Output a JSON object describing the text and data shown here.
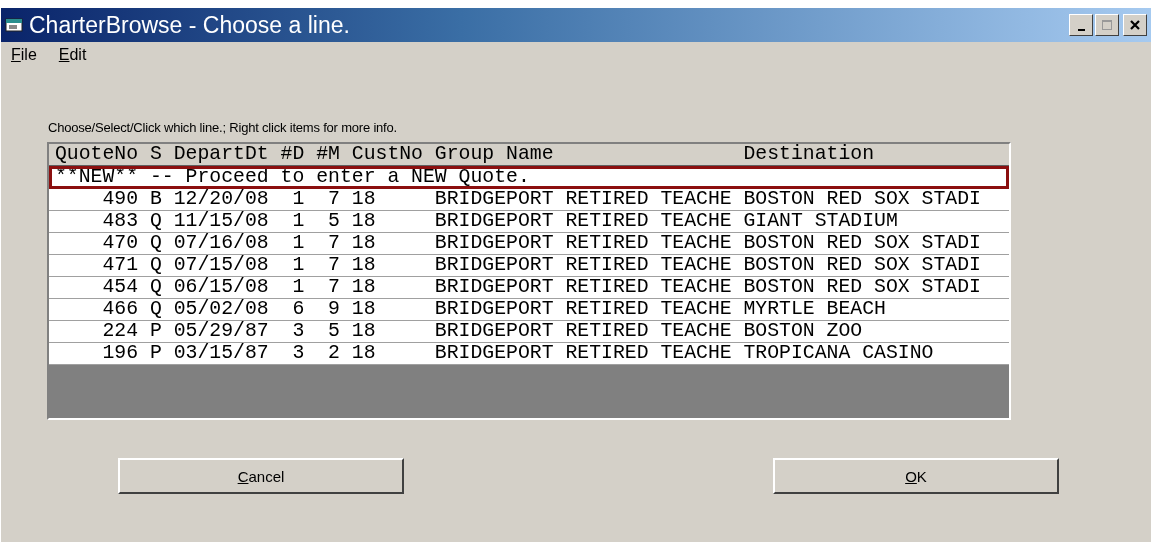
{
  "window": {
    "title": "CharterBrowse - Choose a line."
  },
  "menu": [
    {
      "label": "File",
      "underline_first": true
    },
    {
      "label": "Edit",
      "underline_first": true
    }
  ],
  "prompt": "Choose/Select/Click which line.; Right click items for more info.",
  "list": {
    "header": "QuoteNo S DepartDt #D #M CustNo Group Name                Destination",
    "rows": [
      {
        "text": "**NEW** -- Proceed to enter a NEW Quote.",
        "selected": true
      },
      {
        "text": "    490 B 12/20/08  1  7 18     BRIDGEPORT RETIRED TEACHE BOSTON RED SOX STADI",
        "selected": false
      },
      {
        "text": "    483 Q 11/15/08  1  5 18     BRIDGEPORT RETIRED TEACHE GIANT STADIUM",
        "selected": false
      },
      {
        "text": "    470 Q 07/16/08  1  7 18     BRIDGEPORT RETIRED TEACHE BOSTON RED SOX STADI",
        "selected": false
      },
      {
        "text": "    471 Q 07/15/08  1  7 18     BRIDGEPORT RETIRED TEACHE BOSTON RED SOX STADI",
        "selected": false
      },
      {
        "text": "    454 Q 06/15/08  1  7 18     BRIDGEPORT RETIRED TEACHE BOSTON RED SOX STADI",
        "selected": false
      },
      {
        "text": "    466 Q 05/02/08  6  9 18     BRIDGEPORT RETIRED TEACHE MYRTLE BEACH",
        "selected": false
      },
      {
        "text": "    224 P 05/29/87  3  5 18     BRIDGEPORT RETIRED TEACHE BOSTON ZOO",
        "selected": false
      },
      {
        "text": "    196 P 03/15/87  3  2 18     BRIDGEPORT RETIRED TEACHE TROPICANA CASINO",
        "selected": false
      }
    ]
  },
  "buttons": [
    {
      "label": "Cancel",
      "underline_first": true
    },
    {
      "label": "OK",
      "underline_first": true
    }
  ]
}
